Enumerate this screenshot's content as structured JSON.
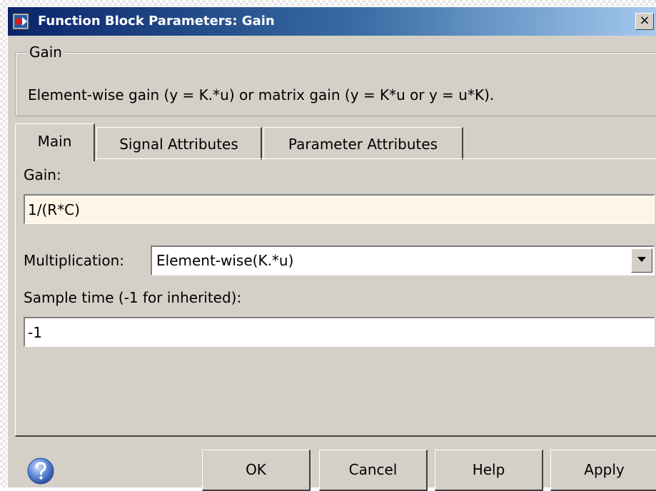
{
  "window": {
    "title": "Function Block Parameters: Gain",
    "close_glyph": "×",
    "icon": "simulink-block-icon"
  },
  "group": {
    "legend": "Gain",
    "description": "Element-wise gain (y = K.*u) or matrix gain (y = K*u or y = u*K)."
  },
  "tabs": [
    {
      "label": "Main",
      "active": true
    },
    {
      "label": "Signal Attributes",
      "active": false
    },
    {
      "label": "Parameter Attributes",
      "active": false
    }
  ],
  "main": {
    "gain_label": "Gain:",
    "gain_value": "1/(R*C)",
    "multiplication_label": "Multiplication:",
    "multiplication_value": "Element-wise(K.*u)",
    "sample_time_label": "Sample time (-1 for inherited):",
    "sample_time_value": "-1"
  },
  "buttons": {
    "ok": "OK",
    "cancel": "Cancel",
    "help": "Help",
    "apply": "Apply"
  },
  "colors": {
    "dialog_bg": "#d4d0c8",
    "titlebar_start": "#0a246a",
    "titlebar_end": "#a6caf0",
    "focused_field_bg": "#fff5e6"
  }
}
